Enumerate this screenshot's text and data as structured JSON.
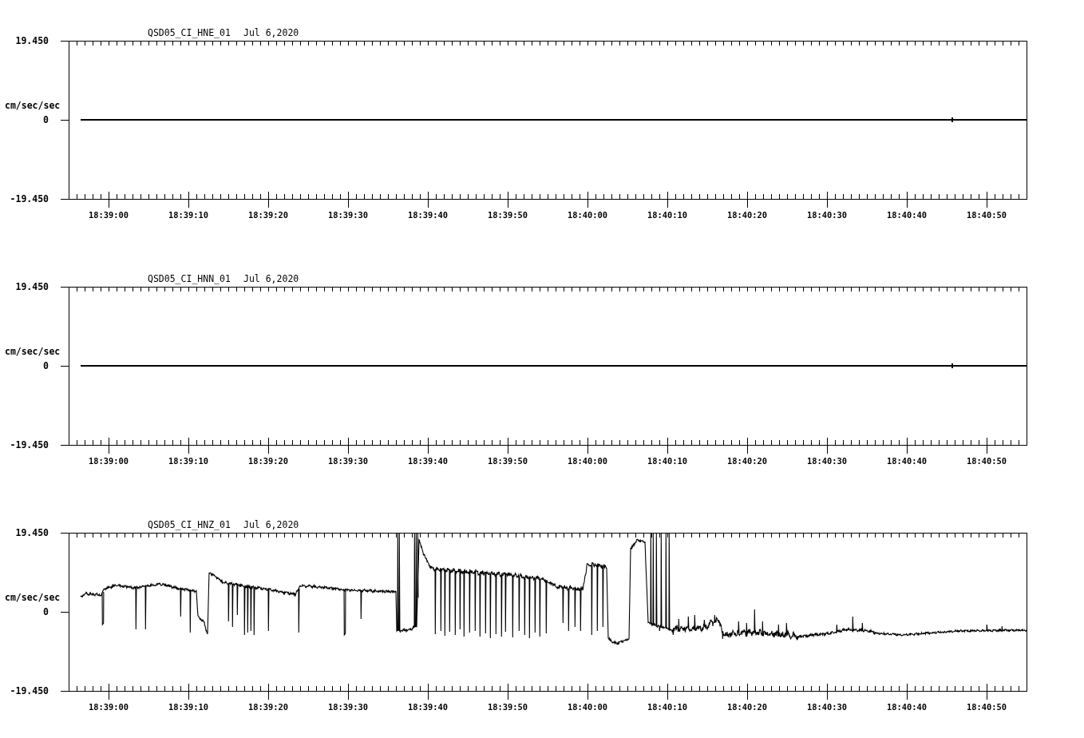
{
  "plots": [
    {
      "channel": "QSD05_CI_HNE_01",
      "date": "Jul 6,2020",
      "unit": "cm/sec/sec",
      "y_ticks": [
        "19.450",
        "0",
        "-19.450"
      ],
      "x_ticks": [
        "18:39:00",
        "18:39:10",
        "18:39:20",
        "18:39:30",
        "18:39:40",
        "18:39:50",
        "18:40:00",
        "18:40:10",
        "18:40:20",
        "18:40:30",
        "18:40:40",
        "18:40:50"
      ],
      "kind": "flat"
    },
    {
      "channel": "QSD05_CI_HNN_01",
      "date": "Jul 6,2020",
      "unit": "cm/sec/sec",
      "y_ticks": [
        "19.450",
        "0",
        "-19.450"
      ],
      "x_ticks": [
        "18:39:00",
        "18:39:10",
        "18:39:20",
        "18:39:30",
        "18:39:40",
        "18:39:50",
        "18:40:00",
        "18:40:10",
        "18:40:20",
        "18:40:30",
        "18:40:40",
        "18:40:50"
      ],
      "kind": "flat"
    },
    {
      "channel": "QSD05_CI_HNZ_01",
      "date": "Jul 6,2020",
      "unit": "cm/sec/sec",
      "y_ticks": [
        "19.450",
        "0",
        "-19.450"
      ],
      "x_ticks": [
        "18:39:00",
        "18:39:10",
        "18:39:20",
        "18:39:30",
        "18:39:40",
        "18:39:50",
        "18:40:00",
        "18:40:10",
        "18:40:20",
        "18:40:30",
        "18:40:40",
        "18:40:50"
      ],
      "kind": "waveform"
    }
  ]
}
